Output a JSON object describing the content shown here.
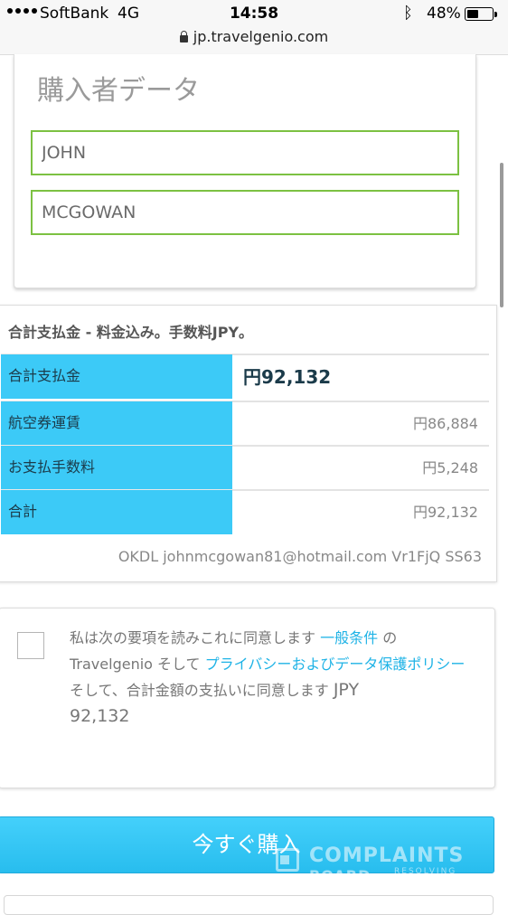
{
  "status_bar": {
    "carrier": "SoftBank",
    "network": "4G",
    "time": "14:58",
    "battery_percent": "48%",
    "battery_level": 0.48,
    "bluetooth_icon": "bluetooth-icon"
  },
  "browser": {
    "url": "jp.travelgenio.com",
    "lock_icon": "lock-icon"
  },
  "buyer": {
    "title": "購入者データ",
    "first_name": "JOHN",
    "last_name": "MCGOWAN"
  },
  "summary": {
    "header": "合計支払金 - 料金込み。手数料JPY。",
    "rows": [
      {
        "label": "合計支払金",
        "value": "円92,132"
      },
      {
        "label": "航空券運賃",
        "value": "円86,884"
      },
      {
        "label": "お支払手数料",
        "value": "円5,248"
      },
      {
        "label": "合計",
        "value": "円92,132"
      }
    ],
    "reference": "OKDL johnmcgowan81@hotmail.com Vr1FjQ SS63"
  },
  "terms": {
    "text1": "私は次の要項を読みこれに同意します",
    "link1": "一般条件",
    "text2": "の Travelgenio そして",
    "link2": "プライバシーおよびデータ保護ポリシー",
    "text3": "そして、合計金額の支払いに同意します",
    "amount_currency": "JPY",
    "amount": "92,132",
    "checked": false
  },
  "buy_button": {
    "label": "今すぐ購入"
  },
  "watermark": {
    "line1": "COMPLAINTS",
    "line2": "BOARD",
    "line3": "RESOLVING"
  }
}
